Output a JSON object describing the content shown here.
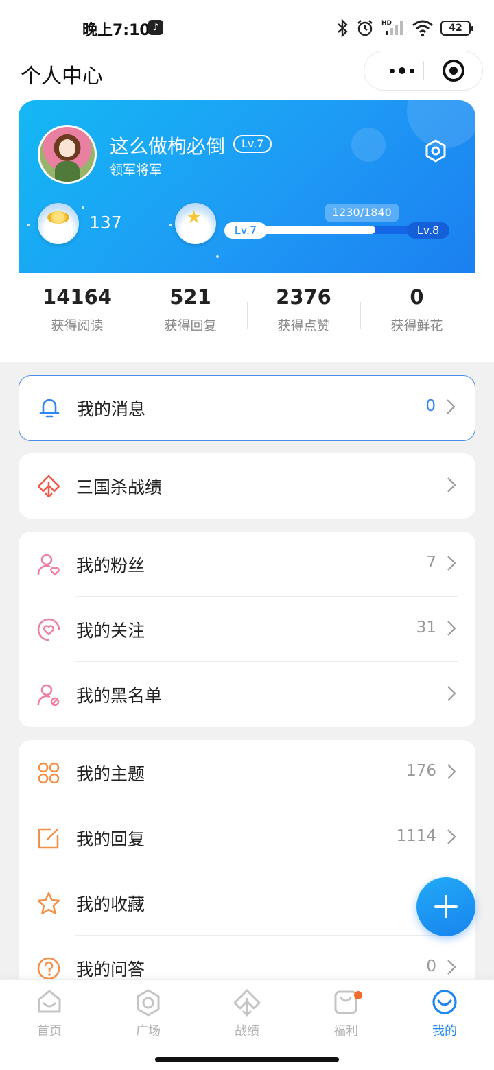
{
  "status_bar": {
    "time": "晚上7:10",
    "battery": "42"
  },
  "header": {
    "title": "个人中心"
  },
  "profile": {
    "username": "这么做枸必倒",
    "level_badge": "Lv.7",
    "rank": "领军将军",
    "coins": "137",
    "exp_text": "1230/1840",
    "exp_progress": 0.668,
    "level_start": "Lv.7",
    "level_end": "Lv.8"
  },
  "stats": [
    {
      "value": "14164",
      "label": "获得阅读"
    },
    {
      "value": "521",
      "label": "获得回复"
    },
    {
      "value": "2376",
      "label": "获得点赞"
    },
    {
      "value": "0",
      "label": "获得鲜花"
    }
  ],
  "menu": {
    "messages": {
      "label": "我的消息",
      "count": "0",
      "icon": "bell-icon",
      "color": "#2f86f0"
    },
    "sgs_record": {
      "label": "三国杀战绩",
      "icon": "sgs-emblem-icon",
      "color": "#ef5a4a"
    },
    "social": [
      {
        "label": "我的粉丝",
        "count": "7",
        "icon": "user-heart-icon"
      },
      {
        "label": "我的关注",
        "count": "31",
        "icon": "heart-bubble-icon"
      },
      {
        "label": "我的黑名单",
        "count": "",
        "icon": "user-block-icon"
      }
    ],
    "content": [
      {
        "label": "我的主题",
        "count": "176",
        "icon": "clover-icon"
      },
      {
        "label": "我的回复",
        "count": "1114",
        "icon": "edit-icon"
      },
      {
        "label": "我的收藏",
        "count": "",
        "icon": "star-icon"
      },
      {
        "label": "我的问答",
        "count": "0",
        "icon": "question-icon"
      }
    ]
  },
  "tabs": [
    {
      "label": "首页",
      "icon": "home-icon"
    },
    {
      "label": "广场",
      "icon": "hexagon-icon"
    },
    {
      "label": "战绩",
      "icon": "emblem-icon"
    },
    {
      "label": "福利",
      "icon": "bag-icon"
    },
    {
      "label": "我的",
      "icon": "smile-icon"
    }
  ],
  "colors": {
    "accent": "#1e88f0",
    "pink": "#ee7f9f",
    "orange": "#f3914b"
  }
}
